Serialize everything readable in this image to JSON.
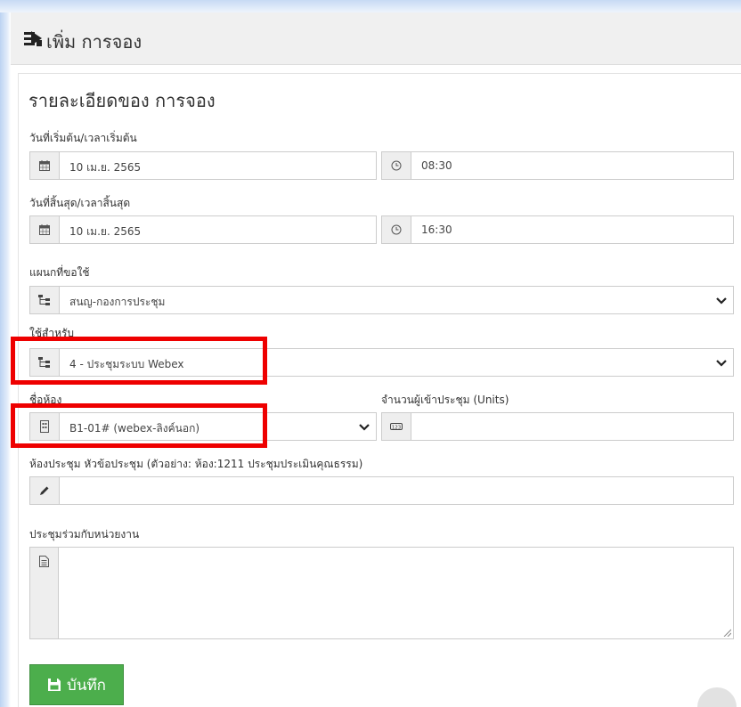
{
  "header": {
    "title": "เพิ่ม การจอง",
    "icon": "form-layers-icon"
  },
  "form": {
    "section_title": "รายละเอียดของ การจอง",
    "start": {
      "label": "วันที่เริ่มต้น/เวลาเริ่มต้น",
      "date": "10 เม.ย. 2565",
      "time": "08:30"
    },
    "end": {
      "label": "วันที่สิ้นสุด/เวลาสิ้นสุด",
      "date": "10 เม.ย. 2565",
      "time": "16:30"
    },
    "department": {
      "label": "แผนกที่ขอใช้",
      "value": "สนญ-กองการประชุม"
    },
    "usage": {
      "label": "ใช้สำหรับ",
      "value": "4 - ประชุมระบบ Webex"
    },
    "room": {
      "label": "ชื่อห้อง",
      "value": "B1-01# (webex-ลิงค์นอก)"
    },
    "attendees": {
      "label": "จำนวนผู้เข้าประชุม (Units)",
      "value": ""
    },
    "topic": {
      "label": "ห้องประชุม หัวข้อประชุม (ตัวอย่าง: ห้อง:1211 ประชุมประเมินคุณธรรม)",
      "value": ""
    },
    "joint": {
      "label": "ประชุมร่วมกับหน่วยงาน",
      "value": ""
    },
    "save_label": "บันทึก"
  },
  "colors": {
    "highlight": "#ee0000",
    "save_button": "#4cae4c",
    "header_bg": "#f0f0f0"
  }
}
